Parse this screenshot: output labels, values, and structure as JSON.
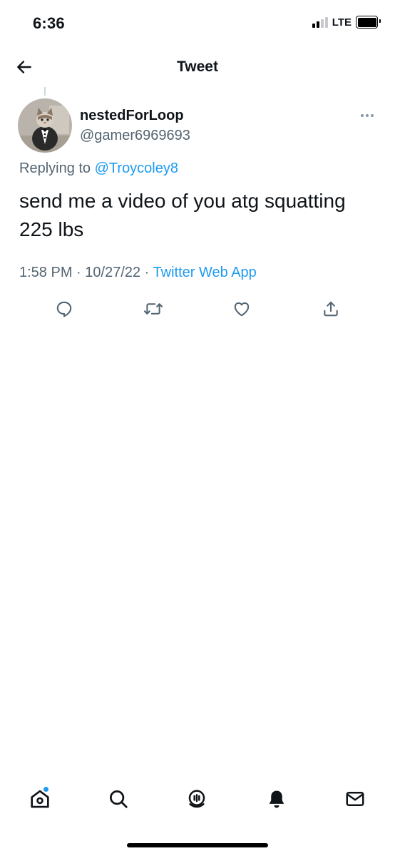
{
  "status_bar": {
    "time": "6:36",
    "network": "LTE",
    "signal_bars": 2,
    "signal_bars_total": 4
  },
  "header": {
    "title": "Tweet",
    "back_icon": "arrow-left-icon"
  },
  "tweet": {
    "display_name": "nestedForLoop",
    "handle": "@gamer6969693",
    "replying_prefix": "Replying to",
    "replying_to": "@Troycoley8",
    "text": "send me a video of you atg squatting 225 lbs",
    "time": "1:58 PM",
    "separator": " · ",
    "date": "10/27/22",
    "source": "Twitter Web App",
    "more_icon": "more-horizontal-icon"
  },
  "actions": [
    {
      "name": "reply",
      "icon": "reply-icon"
    },
    {
      "name": "retweet",
      "icon": "retweet-icon"
    },
    {
      "name": "like",
      "icon": "heart-icon"
    },
    {
      "name": "share",
      "icon": "share-icon"
    }
  ],
  "tab_bar": [
    {
      "name": "home",
      "icon": "home-icon",
      "has_notification": true
    },
    {
      "name": "search",
      "icon": "search-icon"
    },
    {
      "name": "spaces",
      "icon": "spaces-icon"
    },
    {
      "name": "notifications",
      "icon": "bell-icon"
    },
    {
      "name": "messages",
      "icon": "mail-icon"
    }
  ],
  "colors": {
    "accent": "#1d9bf0",
    "text_primary": "#0f1419",
    "text_secondary": "#536471"
  }
}
